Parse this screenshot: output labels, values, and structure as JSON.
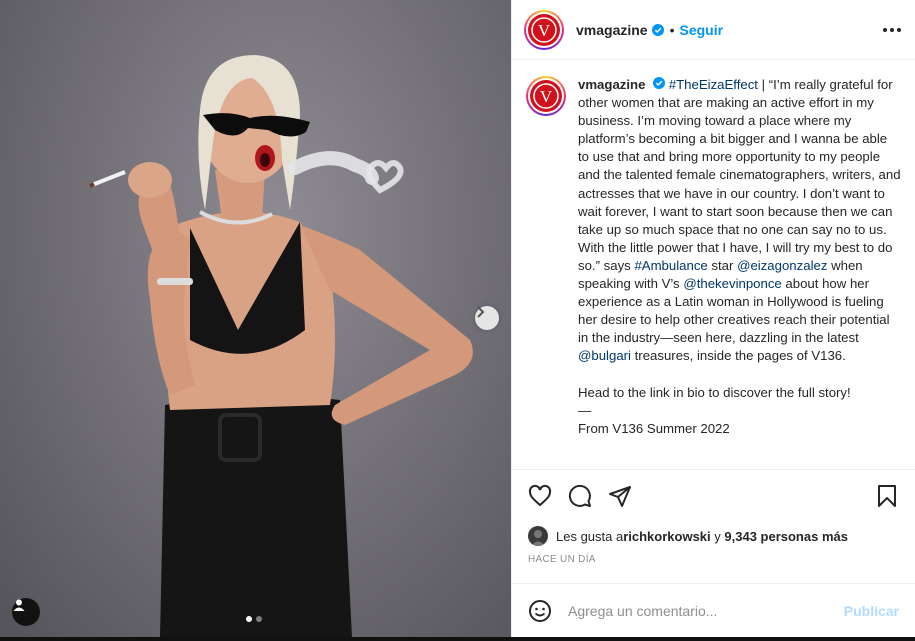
{
  "header": {
    "username": "vmagazine",
    "follow_label": "Seguir",
    "bullet": "•",
    "avatar_letter": "V"
  },
  "caption": {
    "username": "vmagazine",
    "hashtag1": "#TheEizaEffect",
    "text1": " | “I’m really grateful for other women that are making an active effort in my business. I’m moving toward a place where my platform’s becoming a bit bigger and I wanna be able to use that and bring more opportunity to my people and the talented female cinematographers, writers, and actresses that we have in our country. I don’t want to wait forever, I want to start soon because then we can take up so much space that no one can say no to us. With the little power that I have, I will try my best to do so.” says ",
    "hashtag2": "#Ambulance",
    "text2": " star ",
    "mention1": "@eizagonzalez",
    "text3": " when speaking with V’s ",
    "mention2": "@thekevinponce",
    "text4": " about how her experience as a Latin woman in Hollywood is fueling her desire to help other creatives reach their potential in the industry—seen here, dazzling in the latest ",
    "mention3": "@bulgari",
    "text5": " treasures, inside the pages of V136.",
    "para2": "Head to the link in bio to discover the full story!",
    "dash": "—",
    "para3": "From V136 Summer 2022"
  },
  "likes": {
    "prefix": "Les gusta a ",
    "user": "richkorkowski",
    "middle": " y ",
    "count": "9,343 personas más"
  },
  "time_label": "HACE UN DÍA",
  "comment": {
    "placeholder": "Agrega un comentario...",
    "publish_label": "Publicar"
  },
  "carousel": {
    "current": 1,
    "total": 2
  },
  "colors": {
    "accent": "#0095f6",
    "link": "#00376b",
    "publish_disabled": "#b3dbff",
    "brand_red": "#d1121c"
  }
}
